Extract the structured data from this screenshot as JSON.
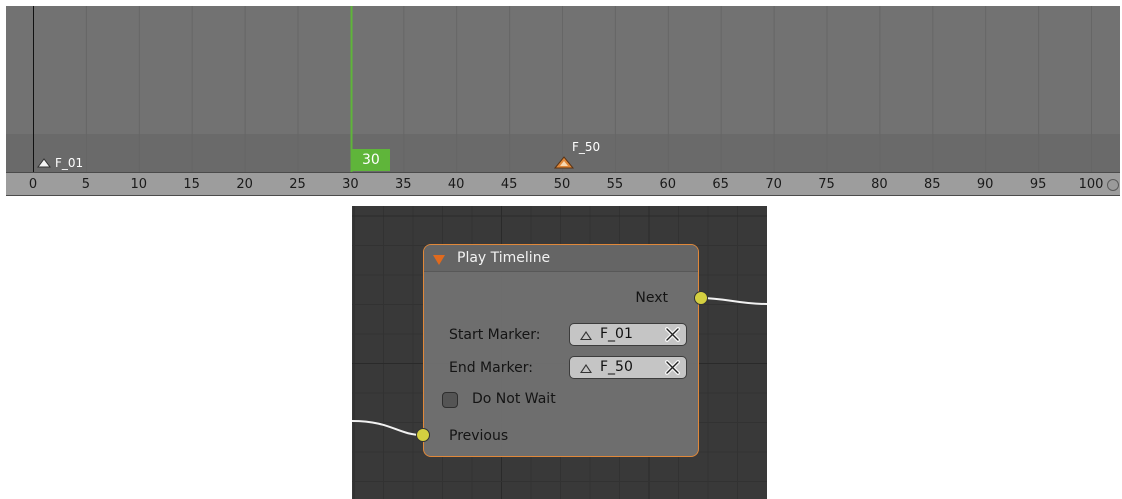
{
  "timeline": {
    "current_frame": "30",
    "markers": [
      {
        "name": "F_01",
        "frame": 1,
        "selected": false
      },
      {
        "name": "F_50",
        "frame": 50,
        "selected": true
      }
    ],
    "ruler_labels": [
      "0",
      "5",
      "10",
      "15",
      "20",
      "25",
      "30",
      "35",
      "40",
      "45",
      "50",
      "55",
      "60",
      "65",
      "70",
      "75",
      "80",
      "85",
      "90",
      "95",
      "100"
    ]
  },
  "node": {
    "title": "Play Timeline",
    "output_socket": "Next",
    "input_socket": "Previous",
    "start_marker": {
      "label": "Start Marker:",
      "value": "F_01"
    },
    "end_marker": {
      "label": "End Marker:",
      "value": "F_50"
    },
    "do_not_wait": {
      "label": "Do Not Wait",
      "checked": false
    }
  },
  "colors": {
    "playhead": "#5fb53a",
    "node_outline": "#e0883a",
    "socket": "#d4cf40",
    "selected_marker": "#e0883a"
  },
  "icons": [
    "collapse-triangle-icon",
    "marker-icon",
    "clear-x-icon"
  ]
}
